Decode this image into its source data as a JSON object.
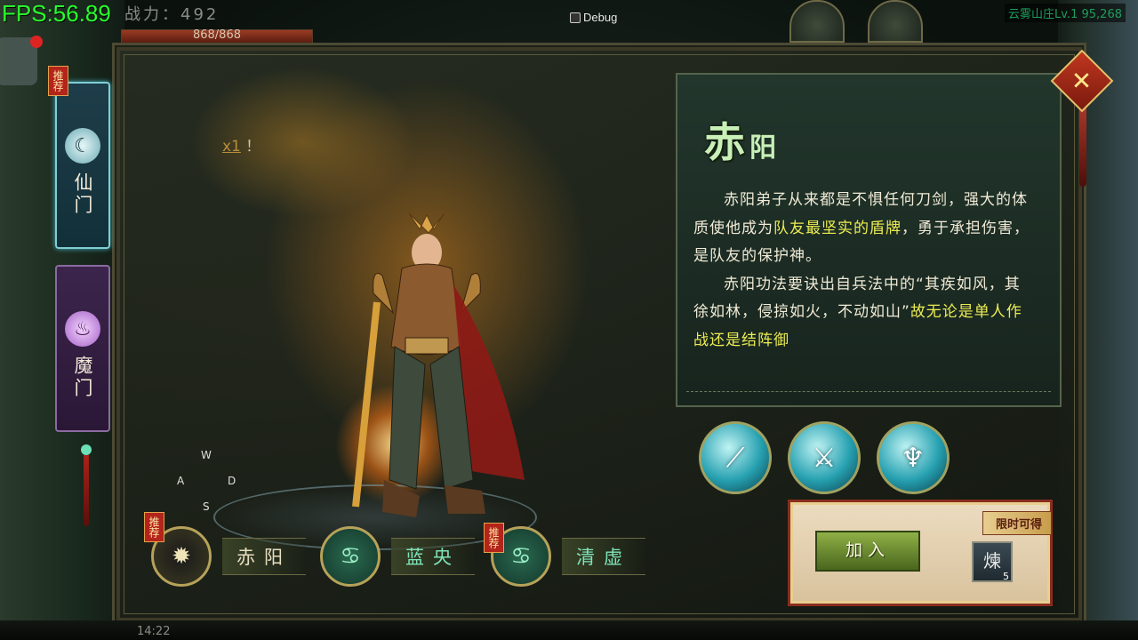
{
  "hud": {
    "fps": "FPS:56.89",
    "power": "战力：492",
    "hp": "868/868",
    "debug": "Debug",
    "level": "云雾山庄Lv.1 95,268",
    "time": "14:22"
  },
  "panel": {
    "bonus_text": "x1",
    "bonus_suffix": "！",
    "tabs": [
      {
        "label": "仙门",
        "icon": "crescent-icon",
        "recommend": "推荐"
      },
      {
        "label": "魔门",
        "icon": "flame-icon"
      }
    ],
    "keys": {
      "w": "W",
      "a": "A",
      "s": "S",
      "d": "D"
    },
    "classes": [
      {
        "name": "赤阳",
        "icon": "sun-icon",
        "recommend": "推荐"
      },
      {
        "name": "蓝央",
        "icon": "swirl-icon"
      },
      {
        "name": "清虚",
        "icon": "swirl-icon",
        "recommend": "推荐"
      }
    ]
  },
  "info": {
    "title_big": "赤",
    "title_small": "阳",
    "para1_a": "赤阳弟子从来都是不惧任何刀剑，强大的体质使他成为",
    "para1_hl": "队友最坚实的盾牌",
    "para1_b": "，勇于承担伤害，是队友的保护神。",
    "para2_a": "赤阳功法要诀出自兵法中的“其疾如风，其徐如林，侵掠如火，不动如山”",
    "para2_hl": "故无论是单人作战还是结阵御",
    "skills": [
      {
        "icon": "slash-icon",
        "glyph": "⟋"
      },
      {
        "icon": "blade-icon",
        "glyph": "⚔"
      },
      {
        "icon": "trident-icon",
        "glyph": "♆"
      }
    ]
  },
  "join": {
    "limited": "限时可得",
    "button": "加入",
    "reward_glyph": "煉",
    "reward_count": "5"
  },
  "colors": {
    "accent_green": "#c9f0b7",
    "highlight_yellow": "#ecec52",
    "fps_green": "#28ff2a"
  }
}
